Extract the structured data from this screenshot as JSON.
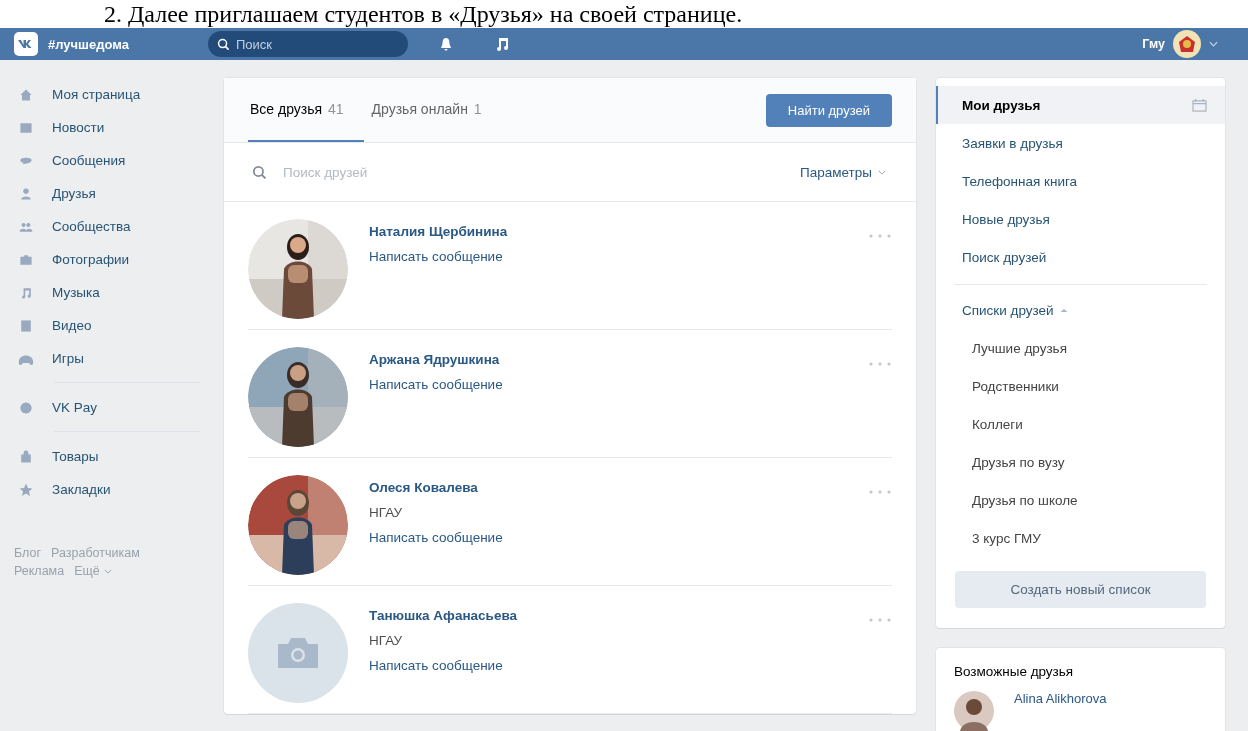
{
  "caption": "2. Далее приглашаем студентов в «Друзья» на своей странице.",
  "header": {
    "site_tag": "#лучшедома",
    "search": {
      "placeholder": "Поиск"
    },
    "user_name": "Гму"
  },
  "sidebar": {
    "groups": [
      [
        "Моя страница",
        "Новости",
        "Сообщения",
        "Друзья",
        "Сообщества",
        "Фотографии",
        "Музыка",
        "Видео",
        "Игры"
      ],
      [
        "VK Pay"
      ],
      [
        "Товары",
        "Закладки"
      ]
    ],
    "footer": [
      "Блог",
      "Разработчикам",
      "Реклама",
      "Ещё"
    ]
  },
  "friends_panel": {
    "tabs": [
      {
        "label": "Все друзья",
        "count": "41",
        "selected": true
      },
      {
        "label": "Друзья онлайн",
        "count": "1",
        "selected": false
      }
    ],
    "find_button": "Найти друзей",
    "search": {
      "placeholder": "Поиск друзей"
    },
    "filter": "Параметры",
    "friends": [
      {
        "name": "Наталия Щербинина",
        "action": "Написать сообщение",
        "kind": "picture"
      },
      {
        "name": "Аржана Ядрушкина",
        "action": "Написать сообщение",
        "kind": "picture"
      },
      {
        "name": "Олеся Ковалева",
        "detail": "НГАУ",
        "action": "Написать сообщение",
        "kind": "picture"
      },
      {
        "name": "Танюшка Афанасьева",
        "detail": "НГАУ",
        "action": "Написать сообщение",
        "kind": "placeholder"
      }
    ]
  },
  "right_menu": {
    "items": [
      {
        "label": "Мои друзья",
        "selected": true
      },
      {
        "label": "Заявки в друзья",
        "selected": false
      },
      {
        "label": "Телефонная книга",
        "selected": false
      },
      {
        "label": "Новые друзья",
        "selected": false
      },
      {
        "label": "Поиск друзей",
        "selected": false
      }
    ],
    "lists": {
      "label": "Списки друзей",
      "expanded": true,
      "items": [
        "Лучшие друзья",
        "Родственники",
        "Коллеги",
        "Друзья по вузу",
        "Друзья по школе",
        "3 курс ГМУ"
      ]
    },
    "create_button": "Создать новый список"
  },
  "possible_friends": {
    "title": "Возможные друзья",
    "people": [
      {
        "name": "Alina Alikhorova"
      }
    ]
  }
}
